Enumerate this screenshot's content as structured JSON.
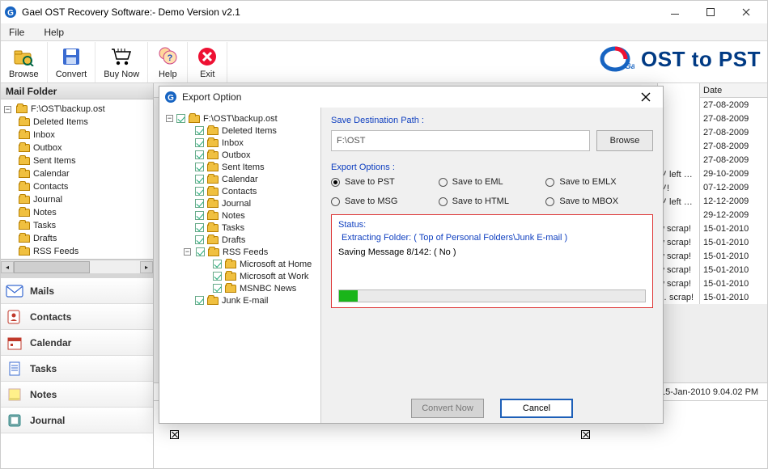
{
  "title": "Gael OST Recovery Software:- Demo Version v2.1",
  "menu": {
    "file": "File",
    "help": "Help"
  },
  "toolbar": {
    "browse": "Browse",
    "convert": "Convert",
    "buynow": "Buy Now",
    "help": "Help",
    "exit": "Exit"
  },
  "brand": {
    "text": "OST to PST",
    "logo_text": "Gael"
  },
  "sidebar": {
    "header": "Mail Folder",
    "root": "F:\\OST\\backup.ost",
    "items": [
      "Deleted Items",
      "Inbox",
      "Outbox",
      "Sent Items",
      "Calendar",
      "Contacts",
      "Journal",
      "Notes",
      "Tasks",
      "Drafts",
      "RSS Feeds"
    ],
    "truncated": "RSS Feeds"
  },
  "navcats": [
    "Mails",
    "Contacts",
    "Calendar",
    "Tasks",
    "Notes",
    "Journal"
  ],
  "list": {
    "date_header": "Date",
    "dates": [
      "27-08-2009",
      "27-08-2009",
      "27-08-2009",
      "27-08-2009",
      "27-08-2009",
      "29-10-2009",
      "07-12-2009",
      "12-12-2009",
      "29-12-2009",
      "15-01-2010",
      "15-01-2010",
      "15-01-2010",
      "15-01-2010",
      "15-01-2010",
      "15-01-2010"
    ],
    "from_fragments": [
      "",
      "",
      "",
      "",
      "",
      "ツ left …",
      "ツ!",
      "ツ left …",
      "",
      "w scrap!",
      "w scrap!",
      "w scrap!",
      "w scrap!",
      "w scrap!",
      "… scrap!"
    ]
  },
  "statusbar": "15-Jan-2010 9.04.02 PM",
  "dialog": {
    "title": "Export Option",
    "left_tree": {
      "root": "F:\\OST\\backup.ost",
      "children": [
        "Deleted Items",
        "Inbox",
        "Outbox",
        "Sent Items",
        "Calendar",
        "Contacts",
        "Journal",
        "Notes",
        "Tasks",
        "Drafts",
        "RSS Feeds"
      ],
      "rss_children": [
        "Microsoft at Home",
        "Microsoft at Work",
        "MSNBC News"
      ],
      "junk": "Junk E-mail"
    },
    "dest_label": "Save Destination Path :",
    "dest_value": "F:\\OST",
    "browse_btn": "Browse",
    "options_label": "Export Options :",
    "radios": [
      "Save to PST",
      "Save to EML",
      "Save to EMLX",
      "Save to MSG",
      "Save to HTML",
      "Save to MBOX"
    ],
    "radio_selected": 0,
    "status_label": "Status:",
    "status_folder": "Extracting Folder: ( Top of Personal Folders\\Junk E-mail )",
    "status_msg": "Saving Message 8/142: ( No )",
    "progress_pct": 6,
    "convert_btn": "Convert Now",
    "cancel_btn": "Cancel"
  }
}
